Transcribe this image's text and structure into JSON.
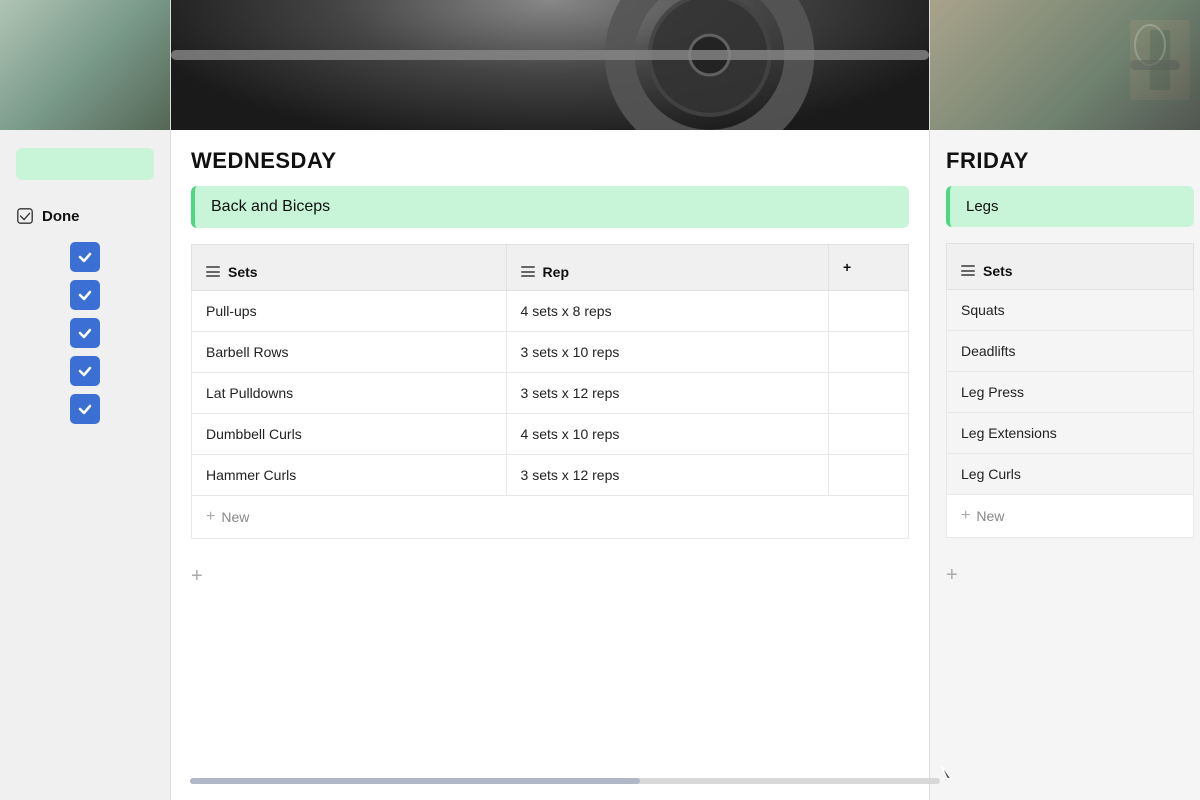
{
  "left_column": {
    "day": "",
    "label": "",
    "done_label": "Done",
    "checkboxes": [
      true,
      true,
      true,
      true,
      true
    ]
  },
  "wednesday": {
    "day": "WEDNESDAY",
    "workout": "Back and Biceps",
    "table": {
      "col_sets": "Sets",
      "col_rep": "Rep",
      "col_add": "+",
      "rows": [
        {
          "exercise": "Pull-ups",
          "reps": "4 sets x 8 reps"
        },
        {
          "exercise": "Barbell Rows",
          "reps": "3 sets x 10 reps"
        },
        {
          "exercise": "Lat Pulldowns",
          "reps": "3 sets x 12 reps"
        },
        {
          "exercise": "Dumbbell Curls",
          "reps": "4 sets x 10 reps"
        },
        {
          "exercise": "Hammer Curls",
          "reps": "3 sets x 12 reps"
        }
      ],
      "new_row_label": "New",
      "add_property_label": "+"
    }
  },
  "friday": {
    "day": "FRIDAY",
    "workout": "Legs",
    "table": {
      "col_sets": "Sets",
      "rows": [
        {
          "exercise": "Squats"
        },
        {
          "exercise": "Deadlifts"
        },
        {
          "exercise": "Leg Press"
        },
        {
          "exercise": "Leg Extensions"
        },
        {
          "exercise": "Leg Curls"
        }
      ],
      "new_row_label": "New",
      "add_property_label": "+"
    }
  }
}
